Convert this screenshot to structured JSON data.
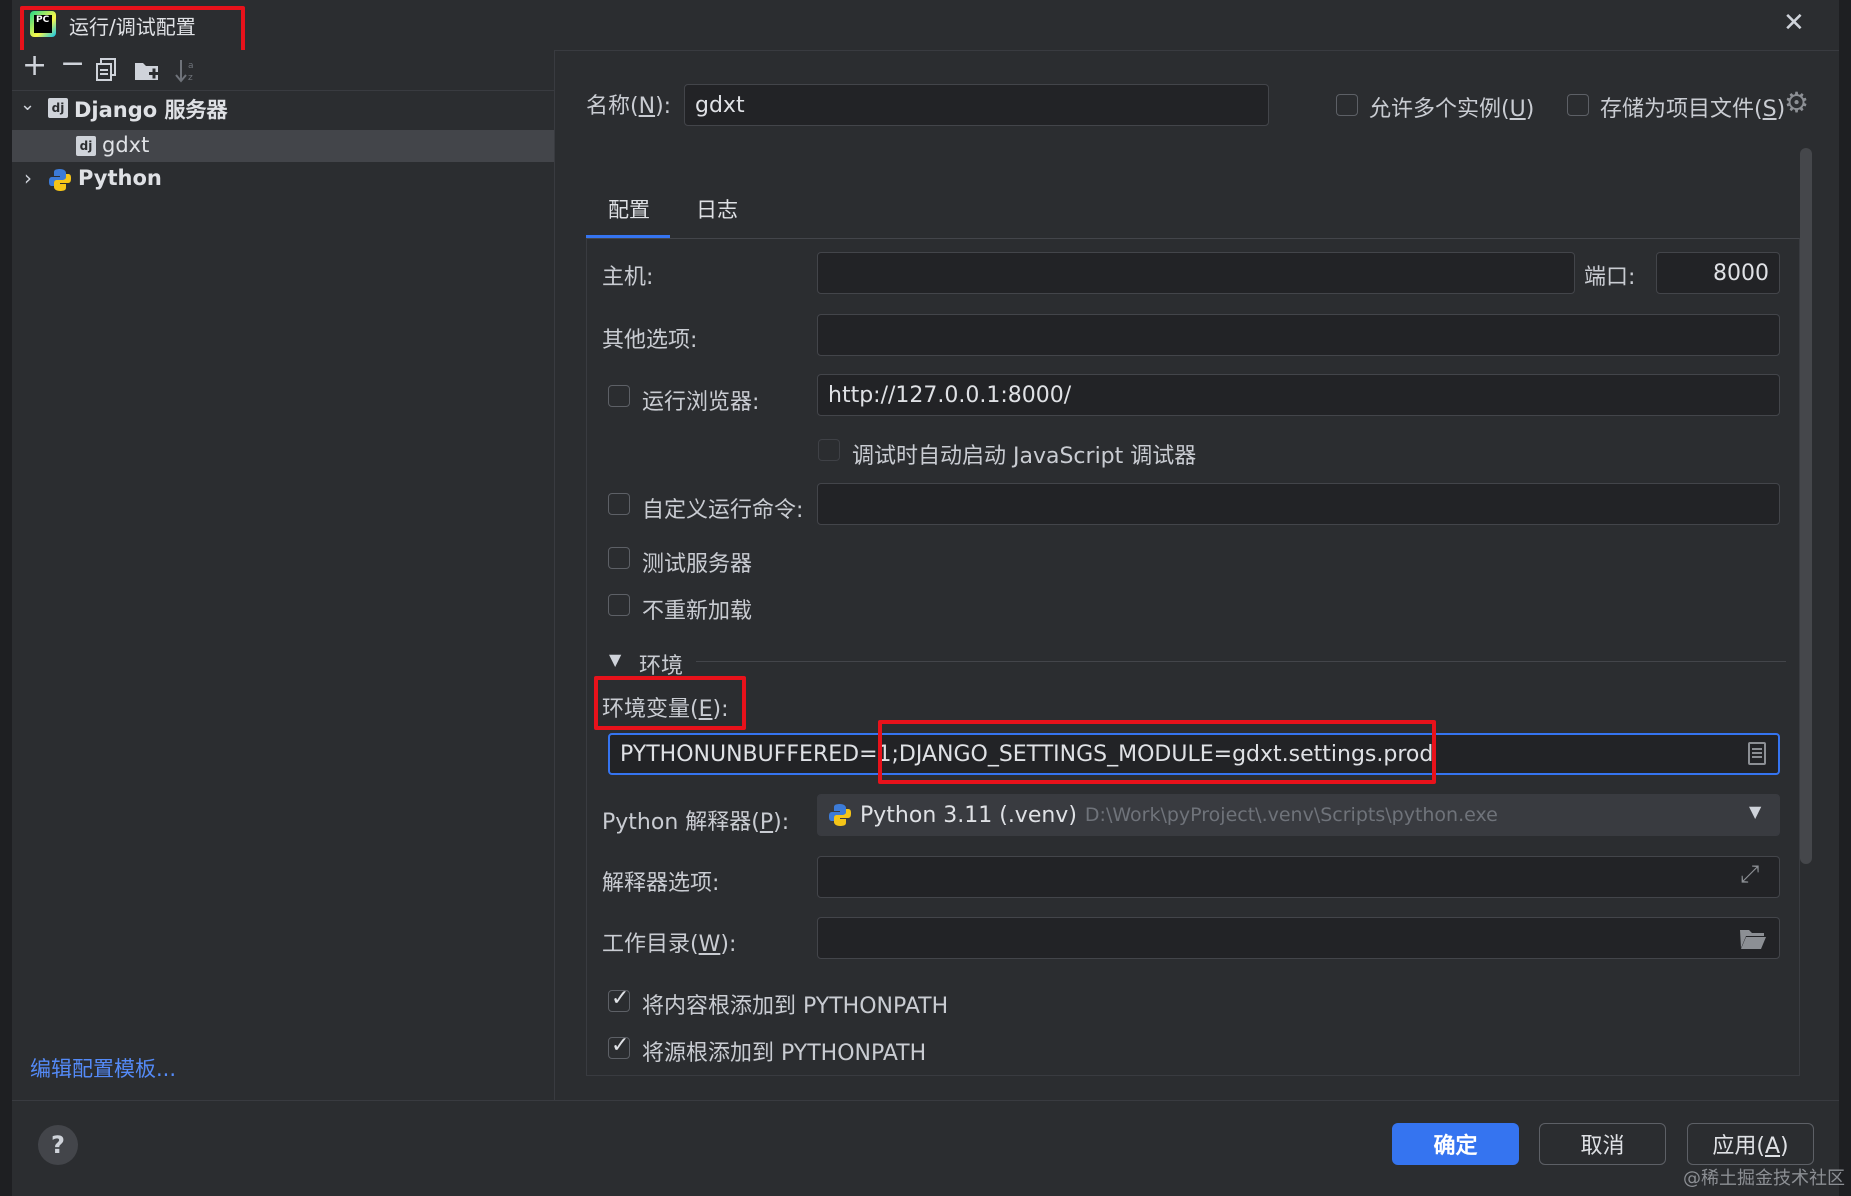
{
  "window": {
    "title": "运行/调试配置",
    "app_icon": "pycharm-icon",
    "close_glyph": "✕"
  },
  "toolbar": {
    "icons": [
      "add-icon",
      "remove-icon",
      "copy-icon",
      "folder-add-icon",
      "sort-icon"
    ]
  },
  "tree": {
    "groups": [
      {
        "label": "Django 服务器",
        "expanded": true,
        "children": [
          {
            "label": "gdxt",
            "selected": true
          }
        ]
      },
      {
        "label": "Python",
        "expanded": false
      }
    ]
  },
  "left_footer": {
    "edit_templates_link": "编辑配置模板..."
  },
  "header": {
    "name_label": "名称(N):",
    "name_value": "gdxt",
    "allow_multiple_label": "允许多个实例(U)",
    "store_as_project_label": "存储为项目文件(S)"
  },
  "tabs": [
    {
      "label": "配置",
      "active": true
    },
    {
      "label": "日志",
      "active": false
    }
  ],
  "form": {
    "host_label": "主机:",
    "host_value": "",
    "port_label": "端口:",
    "port_value": "8000",
    "other_options_label": "其他选项:",
    "other_options_value": "",
    "run_browser_label": "运行浏览器:",
    "run_browser_checked": false,
    "run_browser_url": "http://127.0.0.1:8000/",
    "js_debugger_label": "调试时自动启动 JavaScript 调试器",
    "custom_command_label": "自定义运行命令:",
    "custom_command_value": "",
    "test_server_label": "测试服务器",
    "no_reload_label": "不重新加载",
    "env_section_label": "环境",
    "env_vars_label": "环境变量(E):",
    "env_vars_value": "PYTHONUNBUFFERED=1;DJANGO_SETTINGS_MODULE=gdxt.settings.prod",
    "interpreter_label": "Python 解释器(P):",
    "interpreter_name": "Python 3.11 (.venv)",
    "interpreter_path": "D:\\Work\\pyProject\\.venv\\Scripts\\python.exe",
    "interpreter_options_label": "解释器选项:",
    "interpreter_options_value": "",
    "working_dir_label": "工作目录(W):",
    "working_dir_value": "",
    "add_content_roots_label": "将内容根添加到 PYTHONPATH",
    "add_content_roots_checked": true,
    "add_source_roots_label": "将源根添加到 PYTHONPATH",
    "add_source_roots_checked": true
  },
  "footer": {
    "help_label": "?",
    "ok_label": "确定",
    "cancel_label": "取消",
    "apply_label": "应用(A)"
  },
  "watermark": "@稀土掘金技术社区",
  "colors": {
    "accent": "#3574f0",
    "highlight_red": "#e8121b",
    "background": "#2b2d30"
  }
}
